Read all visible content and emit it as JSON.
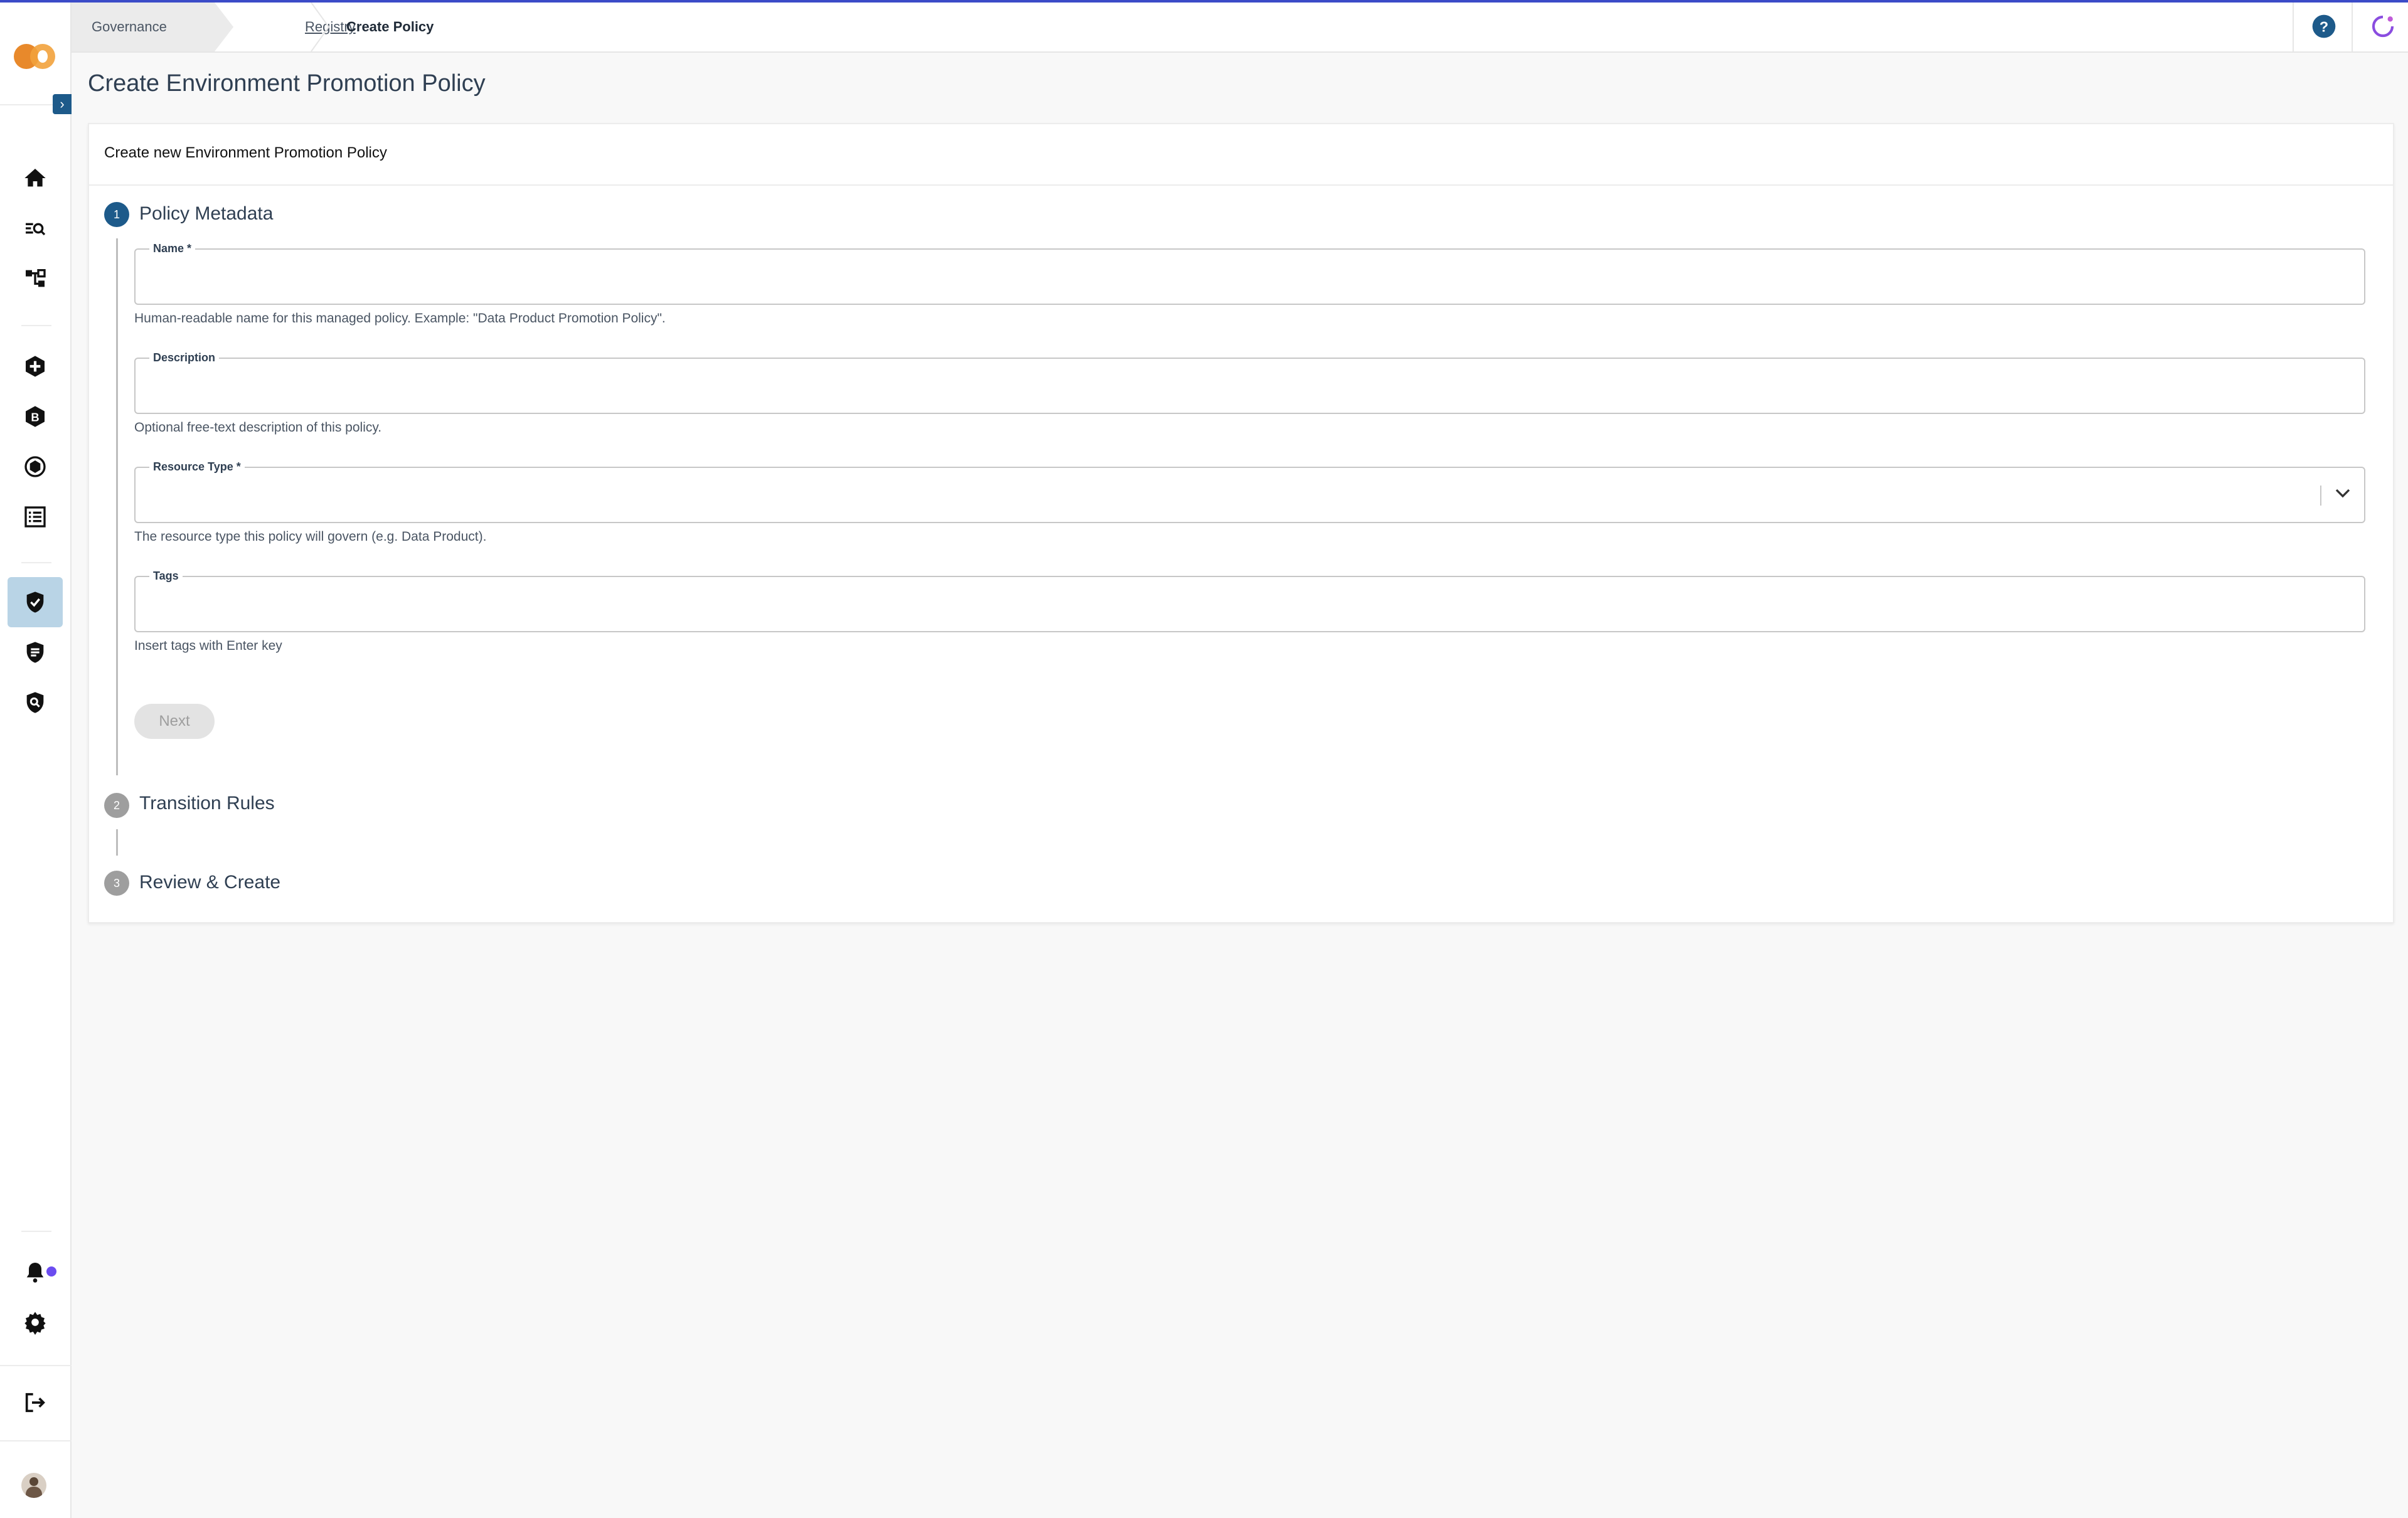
{
  "breadcrumb": {
    "items": [
      {
        "label": "Governance"
      },
      {
        "label": "Registry"
      },
      {
        "label": "Create Policy"
      }
    ]
  },
  "page": {
    "title": "Create Environment Promotion Policy"
  },
  "card": {
    "title": "Create new Environment Promotion Policy"
  },
  "steps": [
    {
      "number": "1",
      "label": "Policy Metadata",
      "state": "active"
    },
    {
      "number": "2",
      "label": "Transition Rules",
      "state": "inactive"
    },
    {
      "number": "3",
      "label": "Review & Create",
      "state": "inactive"
    }
  ],
  "form": {
    "name": {
      "label": "Name *",
      "value": "",
      "helper": "Human-readable name for this managed policy. Example: \"Data Product Promotion Policy\"."
    },
    "description": {
      "label": "Description",
      "value": "",
      "helper": "Optional free-text description of this policy."
    },
    "resource_type": {
      "label": "Resource Type *",
      "value": "",
      "helper": "The resource type this policy will govern (e.g. Data Product)."
    },
    "tags": {
      "label": "Tags",
      "value": "",
      "helper": "Insert tags with Enter key"
    },
    "next_label": "Next"
  },
  "sidebar": {
    "icons": [
      "home-icon",
      "search-list-icon",
      "hierarchy-icon",
      "cross-hexagon-icon",
      "b-hexagon-icon",
      "gear-hexagon-icon",
      "list-icon",
      "shield-check-icon",
      "shield-list-icon",
      "shield-search-icon",
      "bell-icon",
      "settings-icon",
      "logout-icon"
    ],
    "active": "shield-check-icon"
  },
  "colors": {
    "primary": "#1d5a8a",
    "accent_line": "#3b4bc8",
    "active_bg": "#b9d4e6",
    "notification": "#6b4cf0"
  }
}
